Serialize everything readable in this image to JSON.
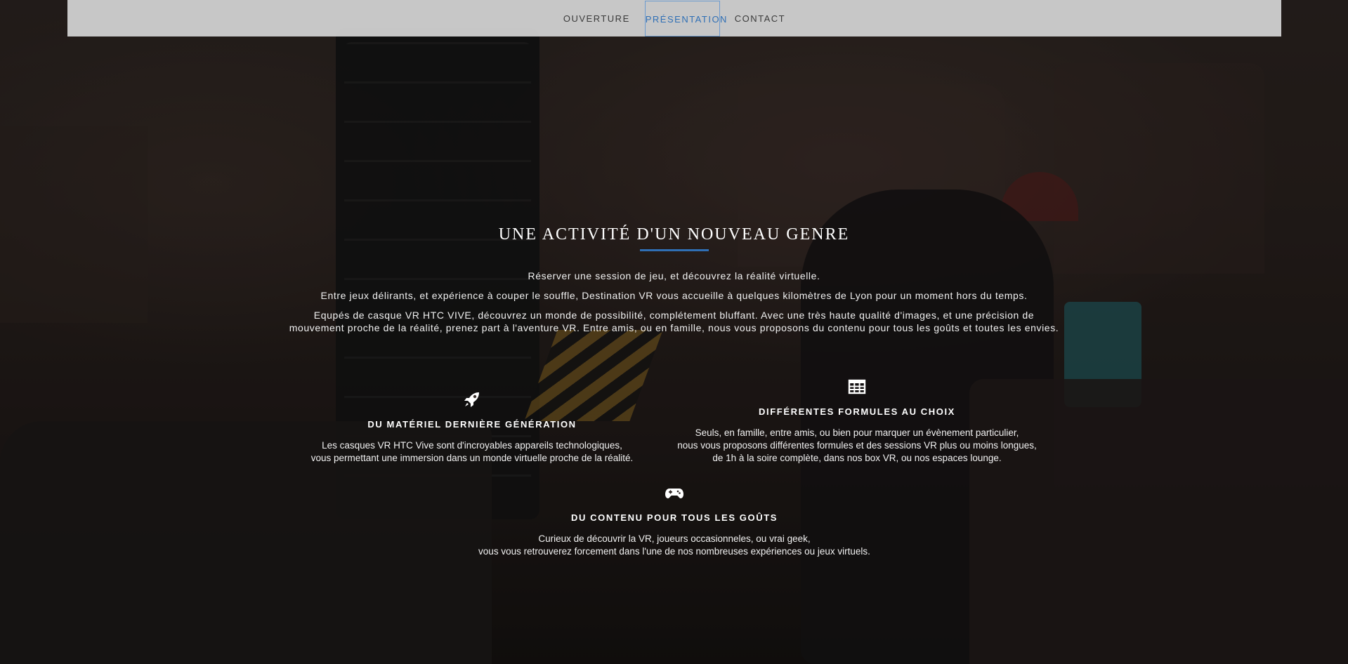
{
  "nav": {
    "items": [
      {
        "label": "OUVERTURE"
      },
      {
        "label": "PRÉSENTATION"
      },
      {
        "label": "CONTACT"
      }
    ],
    "active_color": "#2f6fb5"
  },
  "hero": {
    "title": "UNE ACTIVITÉ D'UN NOUVEAU GENRE",
    "paragraphs": [
      "Réserver une session de jeu, et découvrez la réalité virtuelle.",
      "Entre jeux délirants, et expérience à couper le souffle, Destination VR vous accueille à quelques kilomètres de Lyon pour un moment hors du temps.",
      "Equpés de casque VR HTC VIVE, découvrez un monde de possibilité, complétement bluffant. Avec une très haute qualité d'images, et une précision de",
      "mouvement proche de la réalité, prenez part à l'aventure VR. Entre amis, ou en famille, nous vous proposons du contenu pour tous les goûts et toutes les envies."
    ]
  },
  "features": [
    {
      "icon": "rocket-icon",
      "title": "DU MATÉRIEL DERNIÈRE GÉNÉRATION",
      "lines": [
        "Les casques VR HTC Vive sont d'incroyables appareils technologiques,",
        "vous permettant une immersion dans un monde virtuelle proche de la réalité."
      ]
    },
    {
      "icon": "table-icon",
      "title": "DIFFÉRENTES FORMULES AU CHOIX",
      "lines": [
        "Seuls, en famille, entre amis, ou bien pour marquer un évènement particulier,",
        "nous vous proposons différentes formules et des sessions VR plus ou moins longues,",
        "de 1h à la soire complète, dans nos box VR, ou nos espaces lounge."
      ]
    },
    {
      "icon": "gamepad-icon",
      "title": "DU CONTENU POUR TOUS LES GOÛTS",
      "lines": [
        "Curieux de découvrir la VR, joueurs occasionneles, ou vrai geek,",
        "vous vous retrouverez forcement dans l'une de nos nombreuses expériences ou jeux virtuels."
      ]
    }
  ]
}
